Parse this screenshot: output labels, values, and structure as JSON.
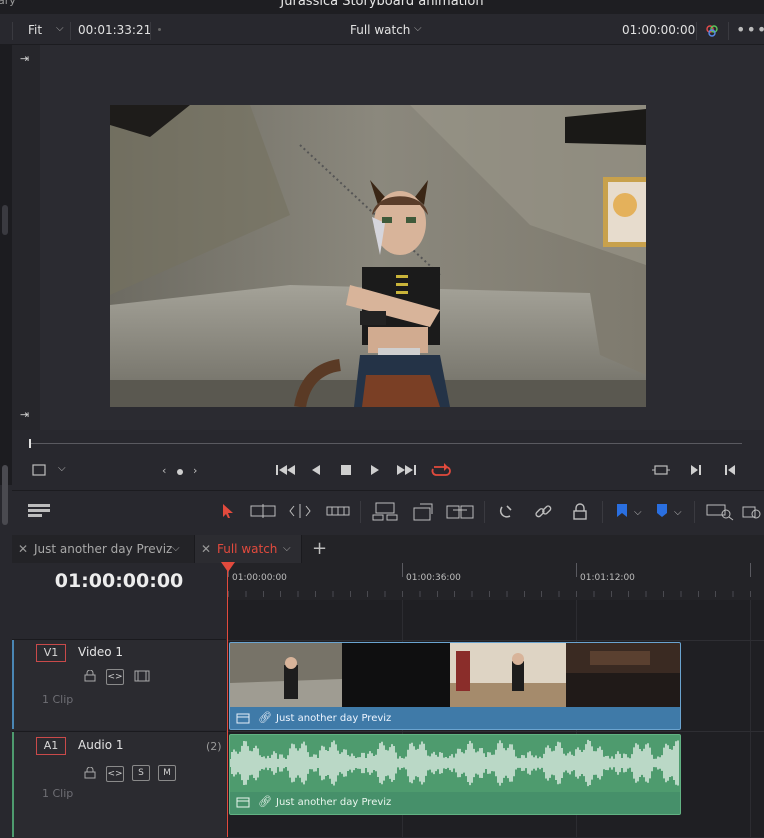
{
  "window": {
    "title": "Jurassica Storyboard animation",
    "library_fragment": "ary"
  },
  "viewer_toolbar": {
    "zoom": "Fit",
    "source_timecode": "00:01:33:21",
    "timeline_name": "Full watch",
    "record_timecode": "01:00:00:00",
    "more_icon": "ellipsis-icon",
    "color_icon": "color-wheel-icon"
  },
  "tabs": [
    {
      "label": "Just another day Previz",
      "active": false
    },
    {
      "label": "Full watch",
      "active": true
    }
  ],
  "timeline": {
    "current_timecode": "01:00:00:00",
    "ruler_labels": [
      "01:00:00:00",
      "01:00:36:00",
      "01:01:12:00"
    ]
  },
  "tracks": {
    "video": {
      "id": "V1",
      "name": "Video 1",
      "clip_count": "1 Clip",
      "clip_name": "Just another day Previz"
    },
    "audio": {
      "id": "A1",
      "name": "Audio 1",
      "channels": "(2)",
      "solo": "S",
      "mute": "M",
      "clip_count": "1 Clip",
      "clip_name": "Just another day Previz"
    }
  },
  "colors": {
    "accent": "#e24a3d",
    "video_clip": "#4a86b4",
    "audio_clip": "#4e9b6e",
    "blue_flag": "#2a6fe0"
  }
}
